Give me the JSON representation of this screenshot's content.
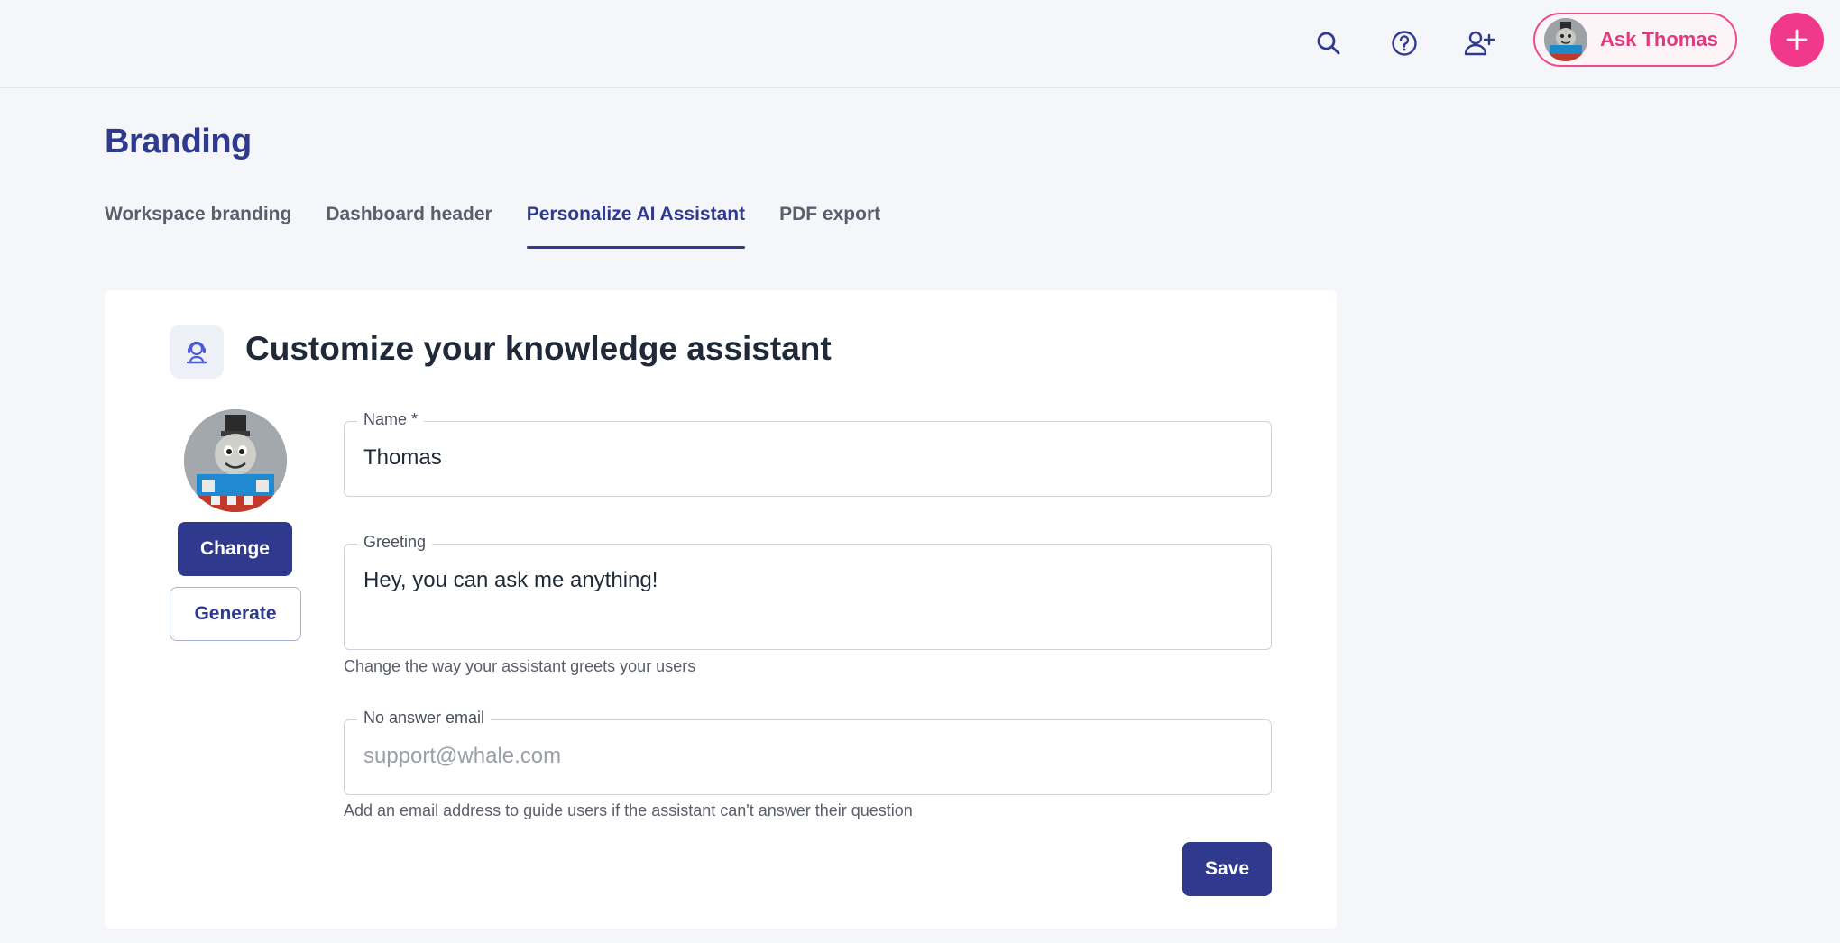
{
  "header": {
    "ask_button_label": "Ask Thomas",
    "icons": [
      "search-icon",
      "help-icon",
      "add-user-icon",
      "plus-icon"
    ]
  },
  "page": {
    "title": "Branding"
  },
  "tabs": [
    {
      "label": "Workspace branding",
      "active": false
    },
    {
      "label": "Dashboard header",
      "active": false
    },
    {
      "label": "Personalize AI Assistant",
      "active": true
    },
    {
      "label": "PDF export",
      "active": false
    }
  ],
  "card": {
    "title": "Customize your knowledge assistant",
    "change_label": "Change",
    "generate_label": "Generate",
    "save_label": "Save"
  },
  "form": {
    "name": {
      "label": "Name *",
      "value": "Thomas"
    },
    "greeting": {
      "label": "Greeting",
      "value": "Hey, you can ask me anything!",
      "helper": "Change the way your assistant greets your users"
    },
    "no_answer_email": {
      "label": "No answer email",
      "placeholder": "support@whale.com",
      "helper": "Add an email address to guide users if the assistant can't answer their question"
    }
  },
  "colors": {
    "primary": "#2f3a8f",
    "accent_pink": "#f0398b",
    "background": "#f5f6fa"
  }
}
